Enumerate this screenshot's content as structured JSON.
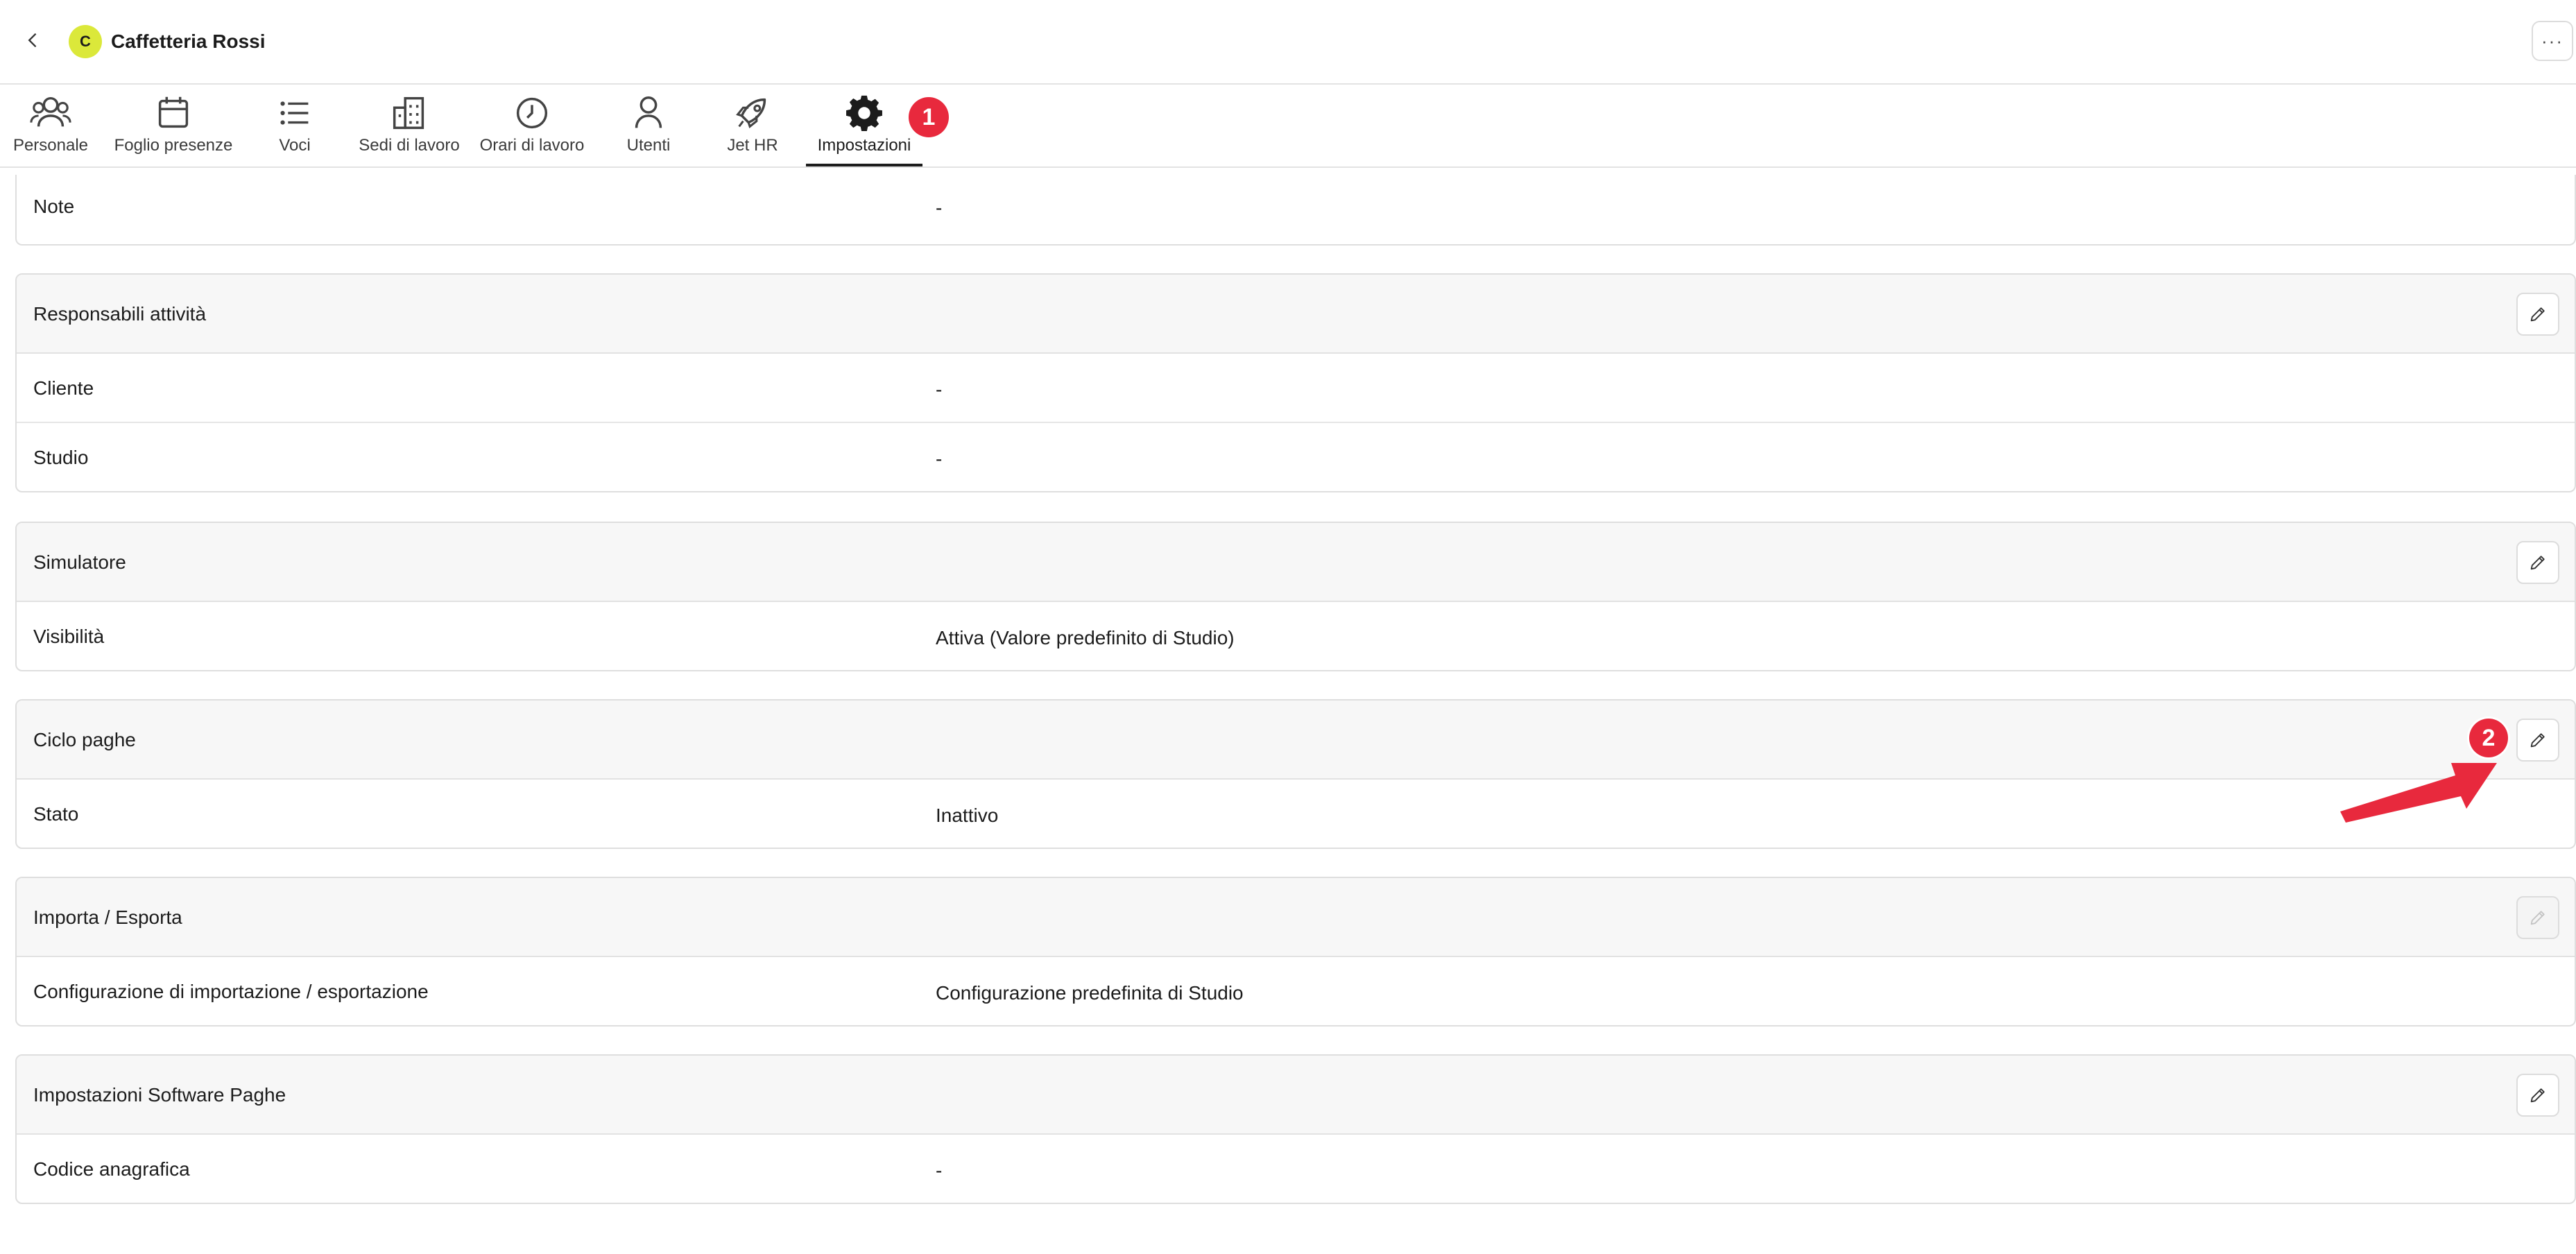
{
  "header": {
    "avatar_initial": "C",
    "company_name": "Caffetteria Rossi",
    "more_label": "···"
  },
  "tabs": [
    {
      "label": "Personale",
      "icon": "people-icon"
    },
    {
      "label": "Foglio presenze",
      "icon": "calendar-icon"
    },
    {
      "label": "Voci",
      "icon": "list-icon"
    },
    {
      "label": "Sedi di lavoro",
      "icon": "building-icon"
    },
    {
      "label": "Orari di lavoro",
      "icon": "clock-icon"
    },
    {
      "label": "Utenti",
      "icon": "user-icon"
    },
    {
      "label": "Jet HR",
      "icon": "rocket-icon"
    },
    {
      "label": "Impostazioni",
      "icon": "gear-icon",
      "active": true
    }
  ],
  "annotations": {
    "step1": "1",
    "step2": "2",
    "color": "#e8293d"
  },
  "sections": {
    "note": {
      "label": "Note",
      "value": "-"
    },
    "responsabili": {
      "title": "Responsabili attività",
      "rows": [
        {
          "label": "Cliente",
          "value": "-"
        },
        {
          "label": "Studio",
          "value": "-"
        }
      ]
    },
    "simulatore": {
      "title": "Simulatore",
      "rows": [
        {
          "label": "Visibilità",
          "value": "Attiva (Valore predefinito di Studio)"
        }
      ]
    },
    "ciclo_paghe": {
      "title": "Ciclo paghe",
      "rows": [
        {
          "label": "Stato",
          "value": "Inattivo"
        }
      ]
    },
    "importa_esporta": {
      "title": "Importa / Esporta",
      "edit_disabled": true,
      "rows": [
        {
          "label": "Configurazione di importazione / esportazione",
          "value": "Configurazione predefinita di Studio"
        }
      ]
    },
    "software_paghe": {
      "title": "Impostazioni Software Paghe",
      "rows": [
        {
          "label": "Codice anagrafica",
          "value": "-"
        }
      ]
    }
  }
}
